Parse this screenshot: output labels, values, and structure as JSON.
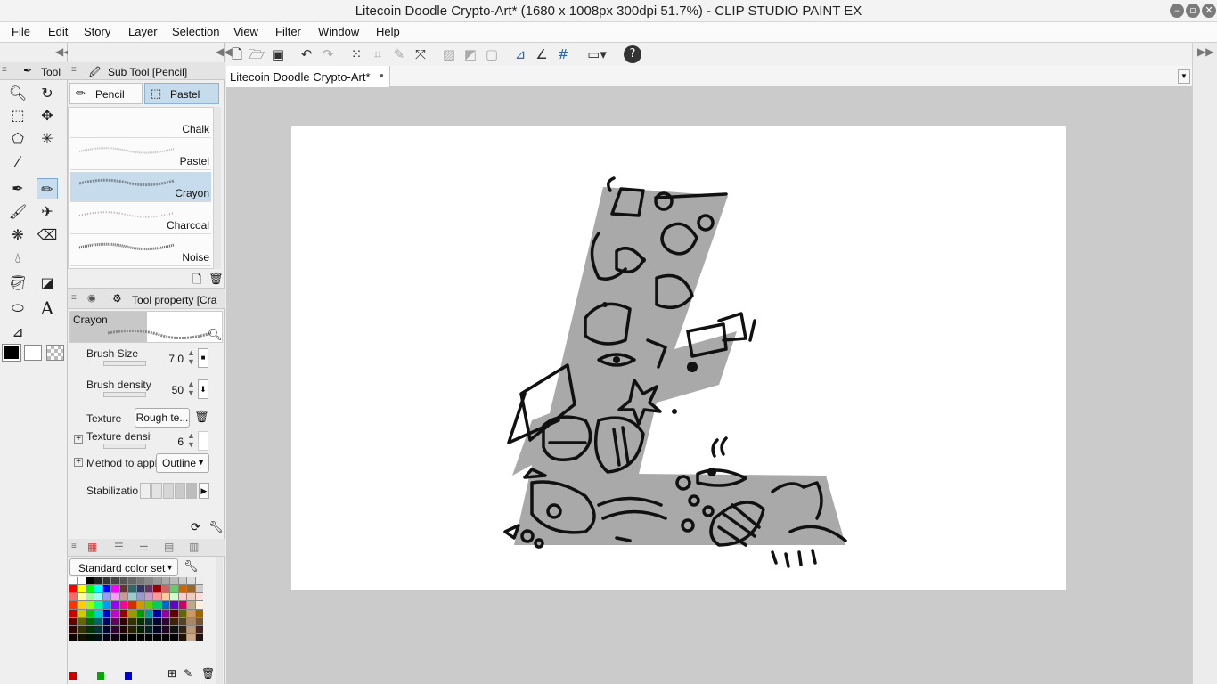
{
  "window": {
    "title": "Litecoin Doodle Crypto-Art* (1680 x 1008px 300dpi 51.7%)  - CLIP STUDIO PAINT EX"
  },
  "menu": [
    "File",
    "Edit",
    "Story",
    "Layer",
    "Selection",
    "View",
    "Filter",
    "Window",
    "Help"
  ],
  "tool_panel": {
    "tab_label": "Tool"
  },
  "subtool_panel": {
    "tab_label": "Sub Tool [Pencil]",
    "groups": [
      "Pencil",
      "Pastel"
    ],
    "brushes": [
      "Chalk",
      "Pastel",
      "Crayon",
      "Charcoal",
      "Noise"
    ],
    "selected_brush": "Crayon"
  },
  "tool_property": {
    "tab_label": "Tool property [Cra",
    "preview_name": "Crayon",
    "brush_size_label": "Brush Size",
    "brush_size_value": "7.0",
    "brush_density_label": "Brush density",
    "brush_density_value": "50",
    "texture_label": "Texture",
    "texture_value": "Rough te...",
    "texture_density_label": "Texture densit",
    "texture_density_value": "6",
    "method_label": "Method to apply",
    "method_value": "Outline",
    "stabilization_label": "Stabilizatio"
  },
  "color_panel": {
    "set_name": "Standard color set"
  },
  "document": {
    "tab_label": "Litecoin Doodle Crypto-Art*"
  },
  "colors": {
    "accent": "#c6dced",
    "canvas_bg": "#cbcbcb",
    "doodle_gray": "#a9a9a9"
  }
}
